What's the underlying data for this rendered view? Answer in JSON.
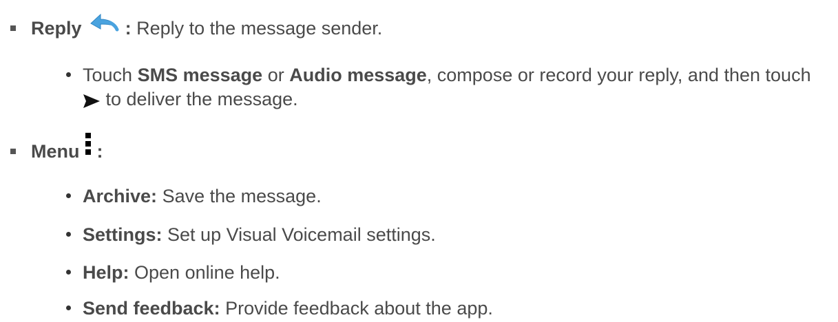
{
  "reply": {
    "label": "Reply",
    "colon": ":",
    "description": "Reply to the message sender.",
    "icon": "reply-arrow-icon",
    "icon_color": "#4aa3df",
    "sub": {
      "part1": "Touch",
      "bold1": "SMS message",
      "part2": "or",
      "bold2": "Audio message",
      "part3": ", compose or record your reply, and then touch",
      "send_icon": "send-arrow-icon",
      "part4": "to deliver the message."
    }
  },
  "menu": {
    "label": "Menu",
    "colon": ":",
    "icon": "vertical-dots-icon",
    "items": [
      {
        "label": "Archive:",
        "description": "Save the message."
      },
      {
        "label": "Settings:",
        "description": "Set up Visual Voicemail settings."
      },
      {
        "label": "Help:",
        "description": "Open online help."
      },
      {
        "label": "Send feedback:",
        "description": "Provide feedback about the app."
      }
    ]
  }
}
